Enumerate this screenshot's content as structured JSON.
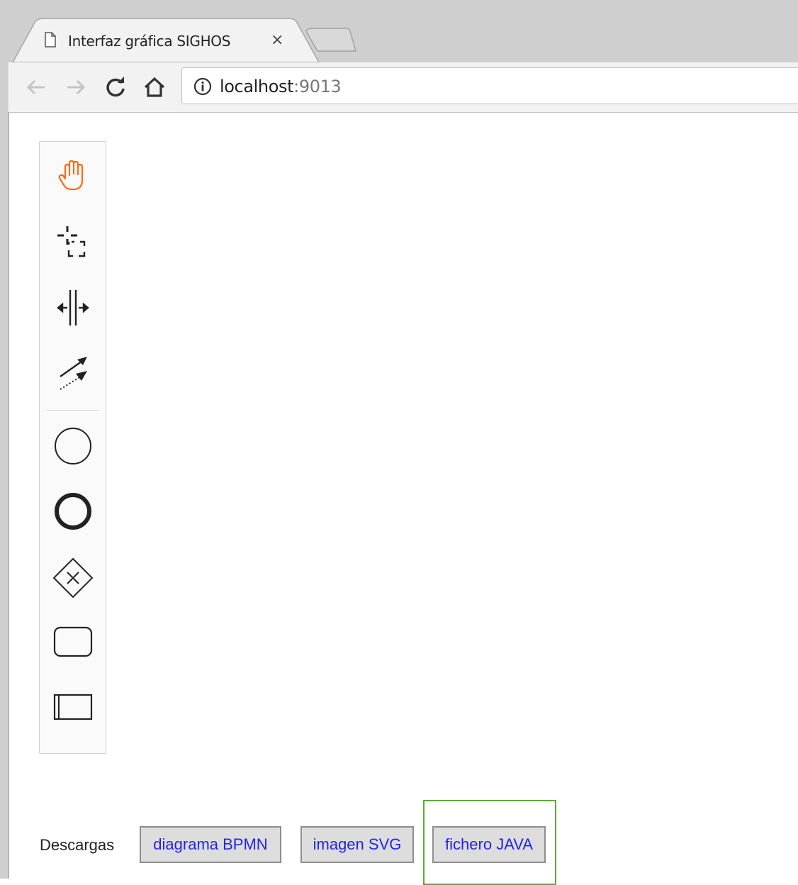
{
  "browser": {
    "tab_title": "Interfaz gráfica SIGHOS",
    "tab_close_glyph": "×",
    "url_host": "localhost",
    "url_port": ":9013",
    "icons": [
      "page-icon",
      "back-arrow-icon",
      "forward-arrow-icon",
      "reload-icon",
      "home-icon",
      "info-icon"
    ]
  },
  "palette": {
    "tools": [
      {
        "name": "hand-tool",
        "icon": "hand-icon",
        "color": "#ff6a1a"
      },
      {
        "name": "lasso-tool",
        "icon": "lasso-icon"
      },
      {
        "name": "space-tool",
        "icon": "space-icon"
      },
      {
        "name": "connect-tool",
        "icon": "connect-icon"
      },
      {
        "name": "start-event",
        "icon": "start-event-icon"
      },
      {
        "name": "end-event",
        "icon": "end-event-icon"
      },
      {
        "name": "exclusive-gateway",
        "icon": "gateway-xor-icon"
      },
      {
        "name": "task",
        "icon": "task-icon"
      },
      {
        "name": "participant",
        "icon": "participant-icon"
      }
    ]
  },
  "downloads": {
    "label": "Descargas",
    "buttons": [
      {
        "label": "diagrama BPMN"
      },
      {
        "label": "imagen SVG"
      },
      {
        "label": "fichero JAVA"
      }
    ],
    "highlight_color": "#5fa83a"
  }
}
